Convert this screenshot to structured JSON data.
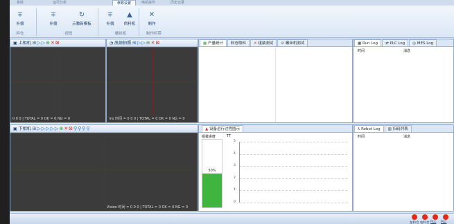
{
  "ribbon": {
    "tabs": [
      "系统",
      "运行分析",
      "参数设置",
      "电机操作",
      "历史记录"
    ],
    "active_tab_index": 2,
    "buttons": [
      {
        "icon": "plus-icon",
        "label": "补偿"
      },
      {
        "icon": "plus-icon",
        "label": "补偿"
      },
      {
        "icon": "refresh-icon",
        "label": "示教新模板"
      },
      {
        "icon": "plus-icon",
        "label": "补偿"
      },
      {
        "icon": "eject-icon",
        "label": "供料机"
      },
      {
        "icon": "shuffle-icon",
        "label": "制作"
      }
    ],
    "groups": [
      "料仓",
      "视觉",
      "螺丝机",
      "制作料带"
    ]
  },
  "camera1": {
    "title": "上相机",
    "status": "0 0 0 | TOTAL = 0 OK = 0 NG = 0"
  },
  "camera2": {
    "title": "底部拍照",
    "status": "ms 时间 = 0 0 0 | TOTAL = 0 OK = 0 NG = 0"
  },
  "camera3": {
    "title": "下相机",
    "status": "Vision 时间 = 0 0 0 | TOTAL = 0 OK = 0 NG = 0"
  },
  "stats_panel": {
    "tabs": [
      "产量统计",
      "料仓取料",
      "组装测试",
      "螺丝机测试"
    ]
  },
  "log_panel": {
    "tabs": [
      "Run Log",
      "PLC Log",
      "MES Log"
    ],
    "col_time": "时间",
    "col_msg": "消息"
  },
  "process_panel": {
    "title": "设备运行过程图示",
    "progress_label": "组装进度",
    "tt_label": "TT",
    "progress_text": "50%",
    "progress_value": 0.5,
    "y_ticks": [
      "5",
      "4",
      "3",
      "2",
      "1",
      "0"
    ]
  },
  "robot_panel": {
    "tabs": [
      "Robot Log",
      "扫码列表"
    ],
    "col_time": "时间",
    "col_msg": "消息"
  },
  "status_lamps": [
    {
      "label": "左料仓",
      "color": "#e02b1c"
    },
    {
      "label": "右料仓",
      "color": "#e02b1c"
    },
    {
      "label": "PLC",
      "color": "#e02b1c"
    },
    {
      "label": "PLC",
      "color": "#e02b1c"
    }
  ]
}
